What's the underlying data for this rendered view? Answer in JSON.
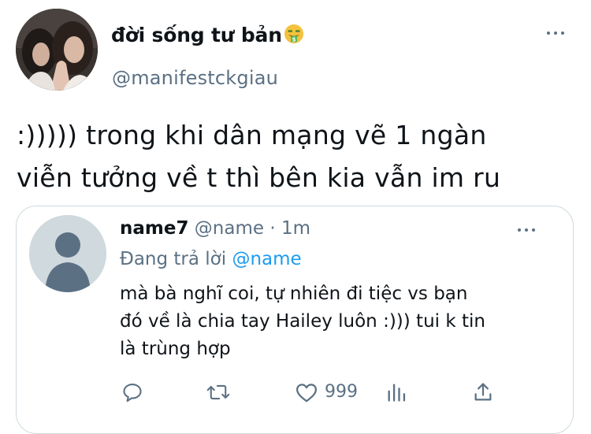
{
  "tweet": {
    "display_name": "đời sống tư bản",
    "name_emoji": "money-mouth-face-emoji",
    "handle": "@manifestckgiau",
    "text_line1": ":))))) trong khi dân mạng vẽ 1 ngàn",
    "text_line2": "viễn tưởng về t thì bên kia vẫn im ru"
  },
  "quoted": {
    "display_name": "name7",
    "meta": "@name · 1m",
    "replying_to_label": "Đang trả lời",
    "replying_to_handle": "@name",
    "text_line1": "mà bà nghĩ coi, tự nhiên đi tiệc vs bạn",
    "text_line2": "đó về là chia tay Hailey luôn :))) tui k tin",
    "text_line3": "là trùng hợp",
    "like_count": "999"
  },
  "icons": {
    "main_more": "more-horizontal-icon",
    "quote_more": "more-horizontal-icon",
    "reply": "reply-icon",
    "retweet": "retweet-icon",
    "like": "heart-icon",
    "analytics": "analytics-icon",
    "share": "share-icon"
  },
  "colors": {
    "text": "#0f1419",
    "secondary": "#5b7083",
    "link": "#1d9bf0",
    "border": "#cfd9de",
    "background": "#ffffff"
  }
}
